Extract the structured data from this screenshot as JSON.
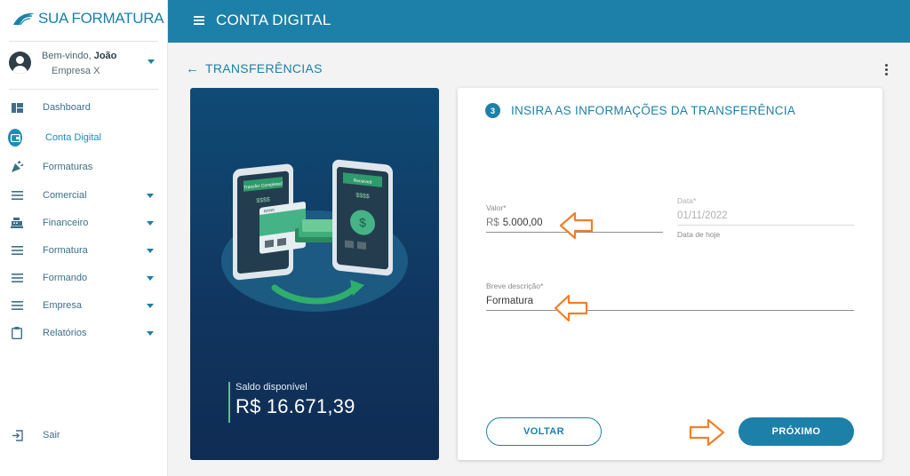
{
  "brand": {
    "name": "SUA FORMATURA",
    "accent": "#1d80a8"
  },
  "user": {
    "greeting": "Bem-vindo,",
    "name": "João",
    "company": "Empresa X"
  },
  "sidebar": {
    "items": [
      {
        "label": "Dashboard",
        "icon": "dashboard-icon",
        "expandable": false
      },
      {
        "label": "Conta Digital",
        "icon": "wallet-icon",
        "expandable": false,
        "active": true
      },
      {
        "label": "Formaturas",
        "icon": "party-popper-icon",
        "expandable": false
      },
      {
        "label": "Comercial",
        "icon": "list-icon",
        "expandable": true
      },
      {
        "label": "Financeiro",
        "icon": "cash-register-icon",
        "expandable": true
      },
      {
        "label": "Formatura",
        "icon": "list-icon",
        "expandable": true
      },
      {
        "label": "Formando",
        "icon": "list-icon",
        "expandable": true
      },
      {
        "label": "Empresa",
        "icon": "list-icon",
        "expandable": true
      },
      {
        "label": "Relatórios",
        "icon": "clipboard-icon",
        "expandable": true
      }
    ],
    "logout": {
      "label": "Sair",
      "icon": "logout-icon"
    }
  },
  "header": {
    "title": "CONTA DIGITAL"
  },
  "page": {
    "title": "TRANSFERÊNCIAS"
  },
  "promo": {
    "balance_label": "Saldo disponível",
    "balance_value": "R$ 16.671,39",
    "phone_left_label": "Transfer Completed",
    "phone_right_label": "Received",
    "card_label": "BANK"
  },
  "form": {
    "step_number": "3",
    "step_title": "INSIRA AS INFORMAÇÕES DA TRANSFERÊNCIA",
    "valor": {
      "label": "Valor*",
      "prefix": "R$",
      "value": "5.000,00"
    },
    "data": {
      "label": "Data*",
      "value": "01/11/2022",
      "hint": "Data de hoje"
    },
    "descricao": {
      "label": "Breve descrição*",
      "value": "Formatura"
    },
    "back_label": "VOLTAR",
    "next_label": "PRÓXIMO"
  },
  "colors": {
    "annotation_arrow": "#f07f2a",
    "positive": "#5fbf8a"
  }
}
